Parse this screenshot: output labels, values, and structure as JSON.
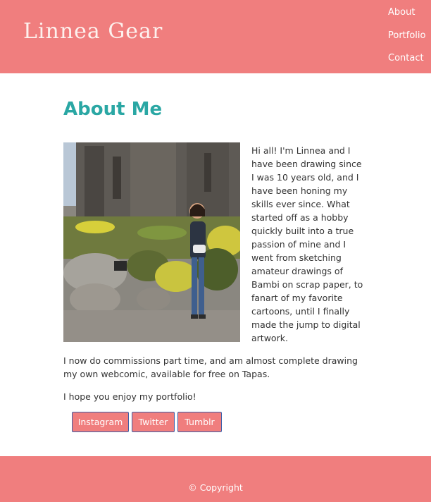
{
  "header": {
    "logo": "Linnea Gear",
    "nav": [
      "About",
      "Portfolio",
      "Contact"
    ]
  },
  "main": {
    "title": "About Me",
    "intro": "Hi all! I'm Linnea and I have been drawing since I was 10 years old, and I have been honing my skills ever since. What started off as a hobby quickly built into a true passion of mine and I went from sketching amateur drawings of Bambi on scrap paper, to fanart of my favorite cartoons, until I finally made the jump to digital artwork.",
    "para2": "I now do commissions part time, and am almost complete drawing my own webcomic, available for free on Tapas.",
    "para3": "I hope you enjoy my portfolio!",
    "buttons": [
      "Instagram",
      "Twitter",
      "Tumblr"
    ]
  },
  "footer": {
    "copyright": "© Copyright"
  },
  "colors": {
    "brand": "#f07e7e",
    "title": "#2aa7a4",
    "button_border": "#3d5fa8"
  }
}
